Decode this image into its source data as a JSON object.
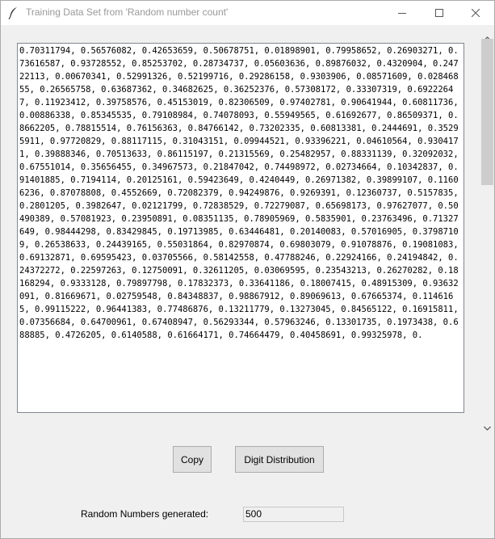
{
  "window": {
    "title": "Training Data Set from 'Random number count'"
  },
  "textarea": {
    "content": "0.70311794, 0.56576082, 0.42653659, 0.50678751, 0.01898901, 0.79958652, 0.26903271, 0.73616587, 0.93728552, 0.85253702, 0.28734737, 0.05603636, 0.89876032, 0.4320904, 0.24722113, 0.00670341, 0.52991326, 0.52199716, 0.29286158, 0.9303906, 0.08571609, 0.02846855, 0.26565758, 0.63687362, 0.34682625, 0.36252376, 0.57308172, 0.33307319, 0.69222647, 0.11923412, 0.39758576, 0.45153019, 0.82306509, 0.97402781, 0.90641944, 0.60811736, 0.00886338, 0.85345535, 0.79108984, 0.74078093, 0.55949565, 0.61692677, 0.86509371, 0.8662205, 0.78815514, 0.76156363, 0.84766142, 0.73202335, 0.60813381, 0.2444691, 0.35295911, 0.97720829, 0.88117115, 0.31043151, 0.09944521, 0.93396221, 0.04610564, 0.9304171, 0.39888346, 0.70513633, 0.86115197, 0.21315569, 0.25482957, 0.88331139, 0.32092032, 0.67551014, 0.35656455, 0.34967573, 0.21847042, 0.74498972, 0.02734664, 0.10342837, 0.91401885, 0.7194114, 0.20125161, 0.59423649, 0.4240449, 0.26971382, 0.39899107, 0.11606236, 0.87078808, 0.4552669, 0.72082379, 0.94249876, 0.9269391, 0.12360737, 0.5157835, 0.2801205, 0.3982647, 0.02121799, 0.72838529, 0.72279087, 0.65698173, 0.97627077, 0.50490389, 0.57081923, 0.23950891, 0.08351135, 0.78905969, 0.5835901, 0.23763496, 0.71327649, 0.98444298, 0.83429845, 0.19713985, 0.63446481, 0.20140083, 0.57016905, 0.37987109, 0.26538633, 0.24439165, 0.55031864, 0.82970874, 0.69803079, 0.91078876, 0.19081083, 0.69132871, 0.69595423, 0.03705566, 0.58142558, 0.47788246, 0.22924166, 0.24194842, 0.24372272, 0.22597263, 0.12750091, 0.32611205, 0.03069595, 0.23543213, 0.26270282, 0.18168294, 0.9333128, 0.79897798, 0.17832373, 0.33641186, 0.18007415, 0.48915309, 0.93632091, 0.81669671, 0.02759548, 0.84348837, 0.98867912, 0.89069613, 0.67665374, 0.1146165, 0.99115222, 0.96441383, 0.77486876, 0.13211779, 0.13273045, 0.84565122, 0.16915811, 0.07356684, 0.64700961, 0.67408947, 0.56293344, 0.57963246, 0.13301735, 0.1973438, 0.688885, 0.4726205, 0.6140588, 0.61664171, 0.74664479, 0.40458691, 0.99325978, 0."
  },
  "buttons": {
    "copy": "Copy",
    "digit_distribution": "Digit Distribution"
  },
  "generated": {
    "label": "Random Numbers generated:",
    "value": "500"
  },
  "icons": {
    "app": "feather-icon",
    "minimize": "minimize-icon",
    "maximize": "maximize-icon",
    "close": "close-icon",
    "scroll_up": "chevron-up-icon",
    "scroll_down": "chevron-down-icon"
  }
}
